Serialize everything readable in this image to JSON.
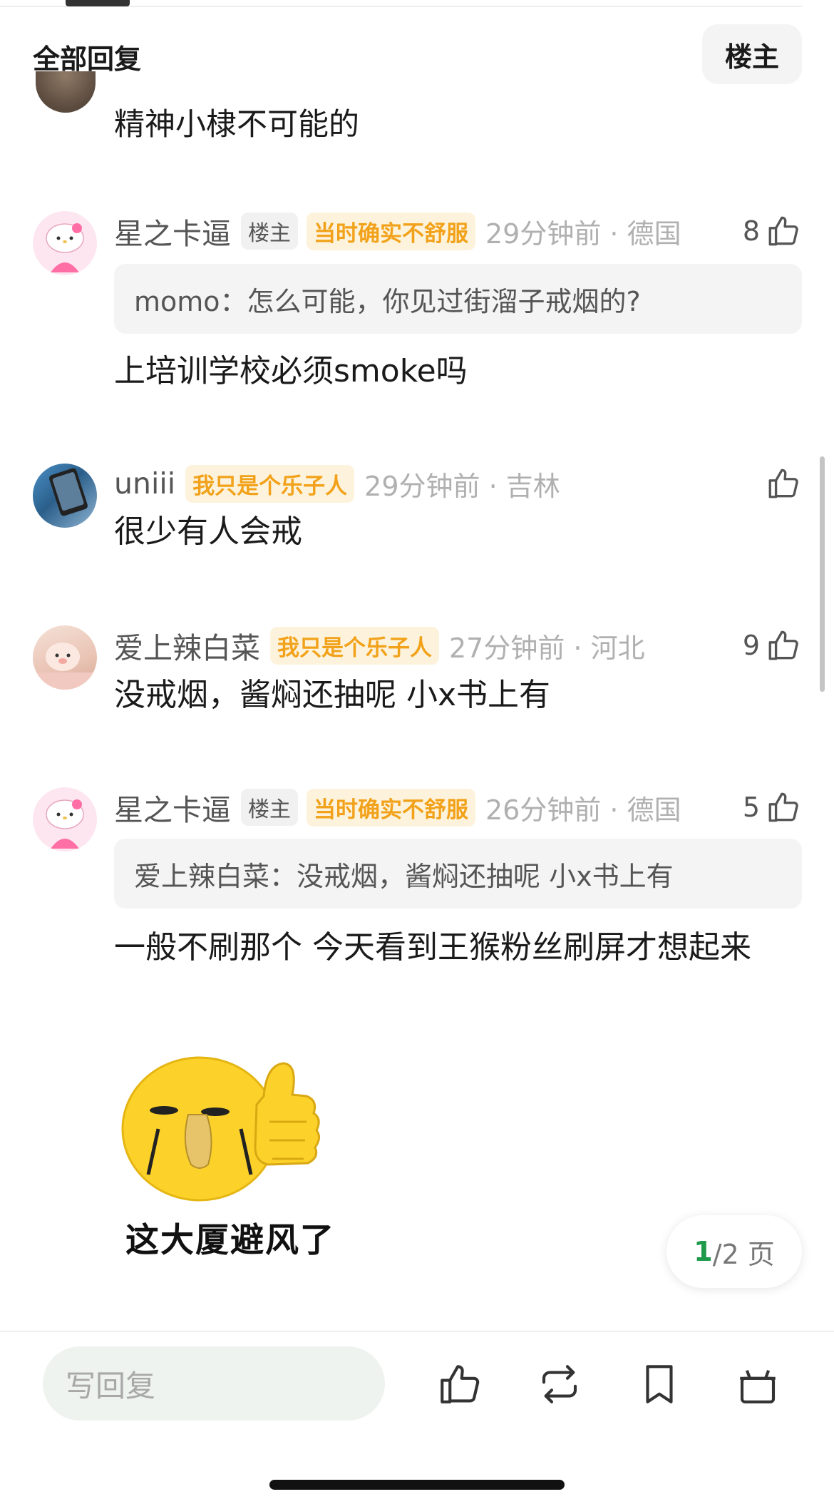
{
  "header": {
    "title": "全部回复",
    "op_filter_label": "楼主"
  },
  "partial_comment": {
    "text": "精神小棣不可能的"
  },
  "comments": [
    {
      "username": "星之卡逼",
      "op_badge": "楼主",
      "flair": "当时确实不舒服",
      "time_location": "29分钟前 · 德国",
      "likes": "8",
      "quote": "momo：怎么可能，你见过街溜子戒烟的?",
      "text": "上培训学校必须smoke吗"
    },
    {
      "username": "uniii",
      "flair": "我只是个乐子人",
      "time_location": "29分钟前 · 吉林",
      "likes": "",
      "text": "很少有人会戒"
    },
    {
      "username": "爱上辣白菜",
      "flair": "我只是个乐子人",
      "time_location": "27分钟前 · 河北",
      "likes": "9",
      "text": "没戒烟，酱焖还抽呢 小x书上有"
    },
    {
      "username": "星之卡逼",
      "op_badge": "楼主",
      "flair": "当时确实不舒服",
      "time_location": "26分钟前 · 德国",
      "likes": "5",
      "quote": "爱上辣白菜：没戒烟，酱焖还抽呢 小x书上有",
      "text": "一般不刷那个 今天看到王猴粉丝刷屏才想起来",
      "sticker_caption": "这大厦避风了"
    }
  ],
  "pager": {
    "current": "1",
    "total_text": "/2 页"
  },
  "bottom_bar": {
    "reply_placeholder": "写回复",
    "icons": [
      "thumbs-up-icon",
      "repost-icon",
      "bookmark-icon",
      "gift-icon"
    ]
  },
  "colors": {
    "flair_text": "#f2a21a",
    "flair_bg": "#fdf3dd",
    "accent_green": "#1f9a4a",
    "meta_gray": "#b0b0b0"
  }
}
